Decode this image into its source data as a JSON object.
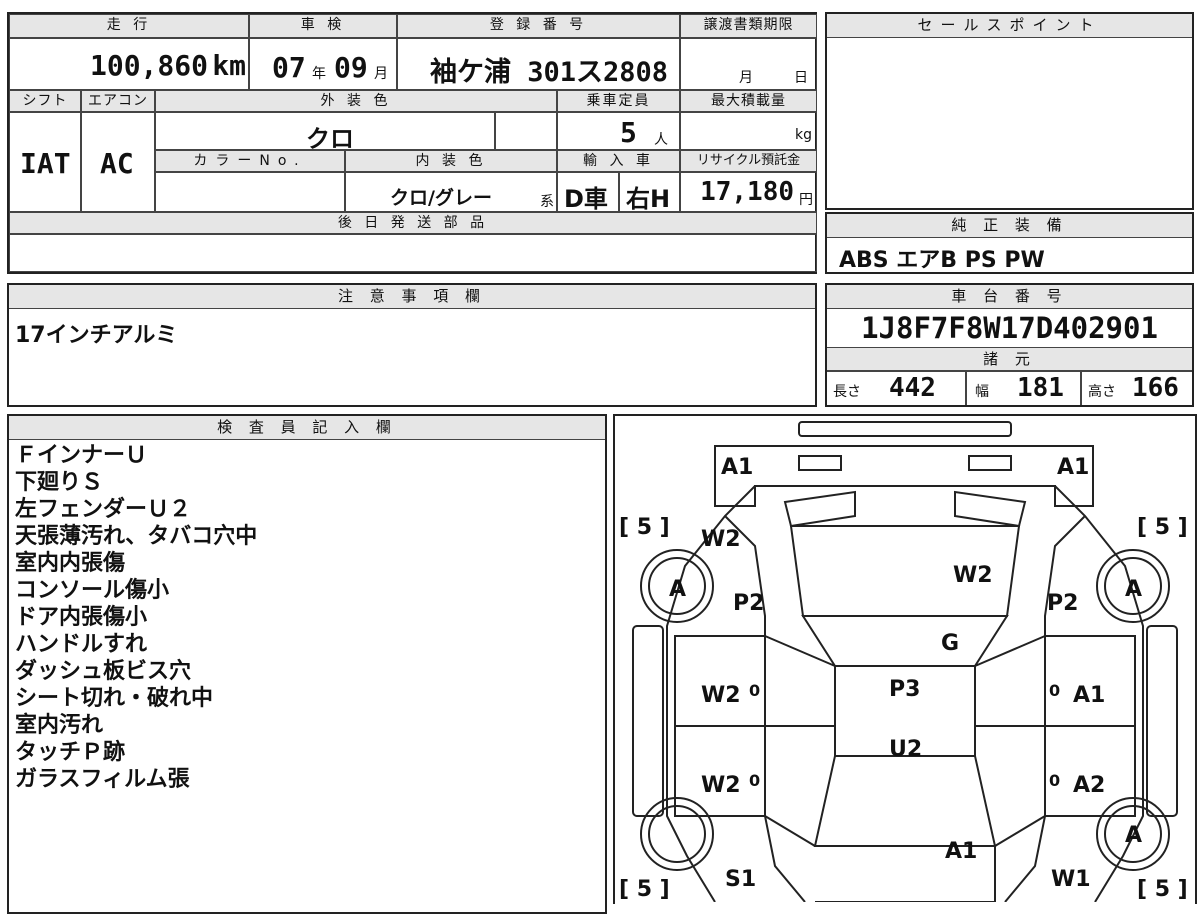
{
  "header": {
    "mileage_label": "走 行",
    "mileage_value": "100,860",
    "mileage_unit": "km",
    "inspection_label": "車 検",
    "inspection_year": "07",
    "inspection_year_unit": "年",
    "inspection_month": "09",
    "inspection_month_unit": "月",
    "registration_label": "登 録 番 号",
    "registration_value": "袖ケ浦 301ス2808",
    "transfer_deadline_label": "譲渡書類期限",
    "transfer_month_unit": "月",
    "transfer_day_unit": "日",
    "sales_point_label": "セールスポイント"
  },
  "row2": {
    "shift_label": "シフト",
    "shift_value": "IAT",
    "ac_label": "エアコン",
    "ac_value": "AC",
    "exterior_color_label": "外 装 色",
    "exterior_color_value": "クロ",
    "capacity_label": "乗車定員",
    "capacity_value": "5",
    "capacity_unit": "人",
    "max_load_label": "最大積載量",
    "max_load_unit": "kg",
    "color_no_label": "カラーNo.",
    "interior_color_label": "内 装 色",
    "interior_color_value": "クロ/グレー",
    "interior_color_suffix": "系",
    "import_label": "輸 入 車",
    "import_value": "D車",
    "handle_value": "右H",
    "recycle_label": "リサイクル預託金",
    "recycle_value": "17,180",
    "recycle_unit": "円"
  },
  "later_parts_label": "後 日 発 送 部 品",
  "standard_equipment": {
    "label": "純 正 装 備",
    "value": "ABS エアB PS PW"
  },
  "notes": {
    "label": "注 意 事 項 欄",
    "value": "17インチアルミ"
  },
  "chassis": {
    "label": "車 台 番 号",
    "value": "1J8F7F8W17D402901"
  },
  "specs": {
    "label": "諸 元",
    "length_label": "長さ",
    "length_value": "442",
    "width_label": "幅",
    "width_value": "181",
    "height_label": "高さ",
    "height_value": "166"
  },
  "inspector": {
    "label": "検 査 員 記 入 欄",
    "lines": [
      "ＦインナーＵ",
      "下廻りＳ",
      "左フェンダーＵ２",
      "天張薄汚れ、タバコ穴中",
      "室内内張傷",
      "コンソール傷小",
      "ドア内張傷小",
      "ハンドルすれ",
      "ダッシュ板ビス穴",
      "シート切れ・破れ中",
      "室内汚れ",
      "タッチＰ跡",
      "ガラスフィルム張"
    ]
  },
  "diagram": {
    "tire_tread_fl": "[ 5 ]",
    "tire_tread_fr": "[ 5 ]",
    "tire_tread_rl": "[ 5 ]",
    "tire_tread_rr": "[ 5 ]",
    "wheel_fl": "A",
    "wheel_fr": "A",
    "wheel_rr": "A",
    "marks": {
      "front_left": "A1",
      "front_right": "A1",
      "left_fender": "W2",
      "windshield": "W2",
      "left_pillar": "P2",
      "right_pillar": "P2",
      "hood_glass": "G",
      "left_front_door": "W2",
      "left_front_door_zero": "0",
      "roof": "P3",
      "right_front_door": "A1",
      "right_front_door_zero": "0",
      "roof_rear": "U2",
      "left_rear_door": "W2",
      "left_rear_door_zero": "0",
      "right_rear_door": "A2",
      "right_rear_door_zero": "0",
      "rear_hatch": "A1",
      "left_quarter": "S1",
      "right_quarter": "W1"
    }
  }
}
